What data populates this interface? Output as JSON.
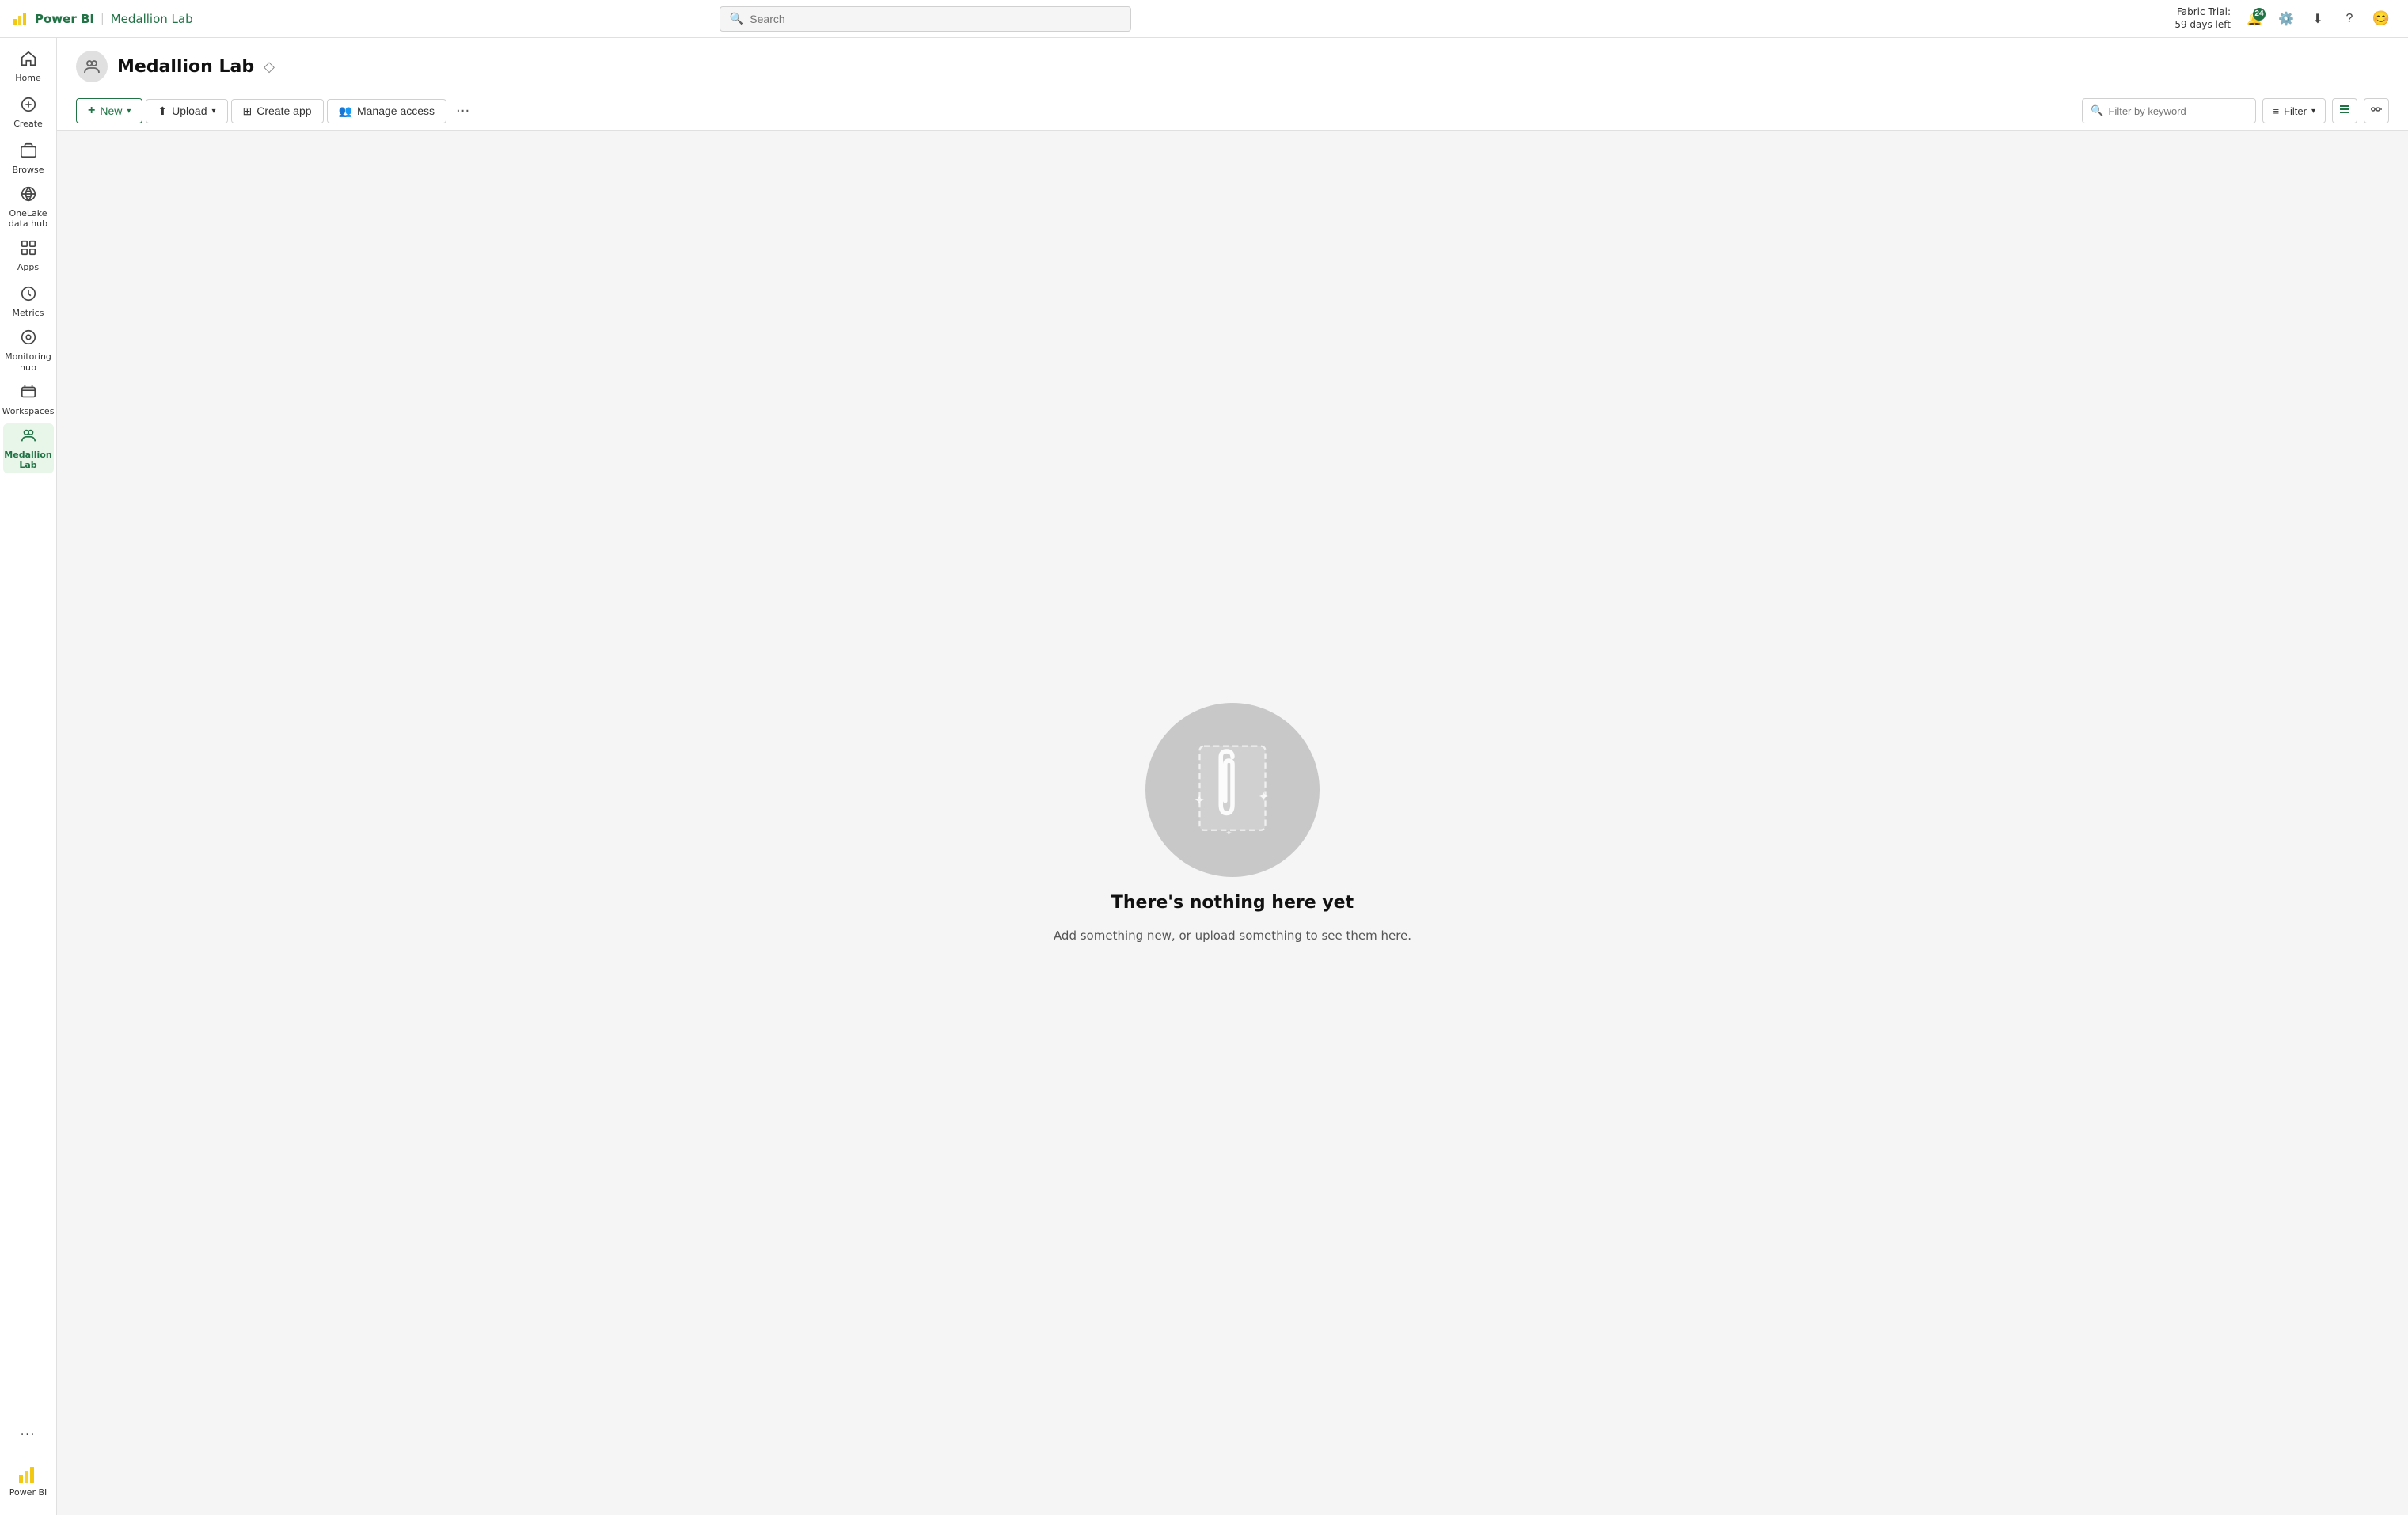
{
  "topbar": {
    "app_name": "Power BI",
    "workspace_name": "Medallion Lab",
    "search_placeholder": "Search",
    "trial_label": "Fabric Trial:",
    "trial_days": "59 days left",
    "notif_count": "24"
  },
  "sidebar": {
    "items": [
      {
        "id": "home",
        "label": "Home",
        "icon": "🏠"
      },
      {
        "id": "create",
        "label": "Create",
        "icon": "➕"
      },
      {
        "id": "browse",
        "label": "Browse",
        "icon": "📁"
      },
      {
        "id": "onelake",
        "label": "OneLake\ndata hub",
        "icon": "🔵"
      },
      {
        "id": "apps",
        "label": "Apps",
        "icon": "⊞"
      },
      {
        "id": "metrics",
        "label": "Metrics",
        "icon": "📊"
      },
      {
        "id": "monitoring",
        "label": "Monitoring\nhub",
        "icon": "⊙"
      },
      {
        "id": "workspaces",
        "label": "Workspaces",
        "icon": "🗂"
      },
      {
        "id": "medallion",
        "label": "Medallion\nLab",
        "icon": "👥",
        "active": true
      }
    ],
    "more_label": "...",
    "powerbi_label": "Power BI"
  },
  "workspace": {
    "title": "Medallion Lab",
    "icon_label": "workspace-icon"
  },
  "toolbar": {
    "new_label": "New",
    "upload_label": "Upload",
    "create_app_label": "Create app",
    "manage_access_label": "Manage access",
    "more_icon": "···",
    "filter_placeholder": "Filter by keyword",
    "filter_label": "Filter"
  },
  "empty_state": {
    "title": "There's nothing here yet",
    "subtitle": "Add something new, or upload something to see them here."
  }
}
